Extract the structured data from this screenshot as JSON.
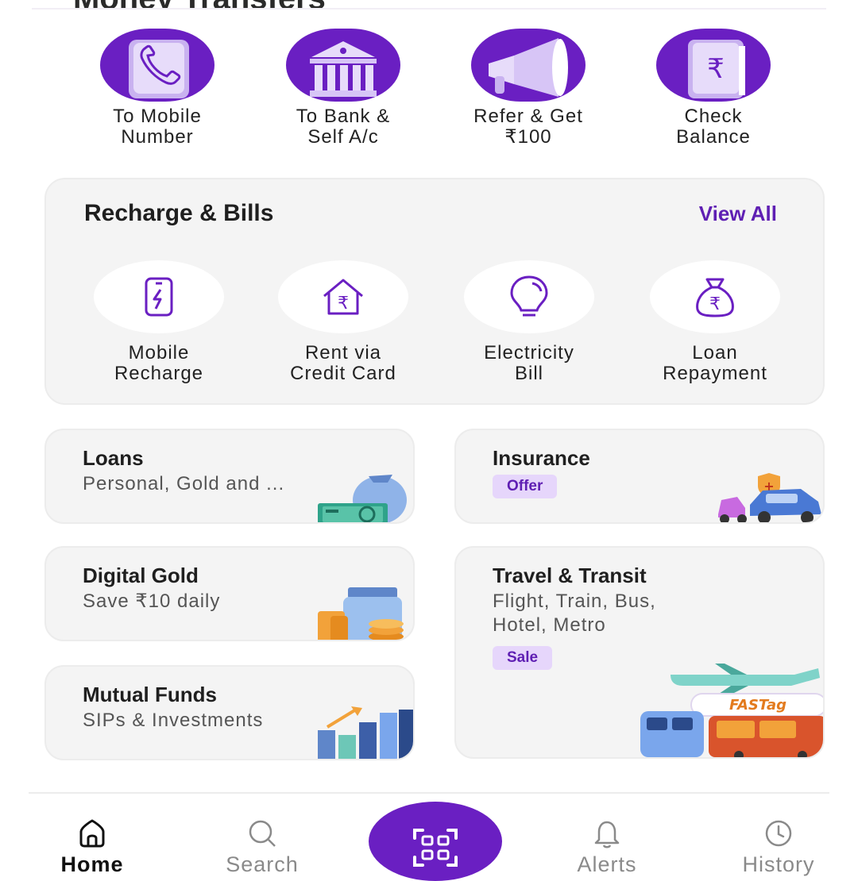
{
  "header": {
    "title_clipped": "Money Transfers"
  },
  "money_transfer": [
    {
      "label_line1": "To Mobile",
      "label_line2": "Number",
      "icon": "phone-icon"
    },
    {
      "label_line1": "To Bank &",
      "label_line2": "Self A/c",
      "icon": "bank-icon"
    },
    {
      "label_line1": "Refer & Get",
      "label_line2": "₹100",
      "icon": "megaphone-icon"
    },
    {
      "label_line1": "Check",
      "label_line2": "Balance",
      "icon": "rupee-book-icon"
    }
  ],
  "recharge_bills": {
    "title": "Recharge & Bills",
    "view_all": "View All",
    "items": [
      {
        "label_line1": "Mobile",
        "label_line2": "Recharge",
        "icon": "mobile-recharge-icon"
      },
      {
        "label_line1": "Rent via",
        "label_line2": "Credit Card",
        "icon": "house-rupee-icon"
      },
      {
        "label_line1": "Electricity",
        "label_line2": "Bill",
        "icon": "bulb-icon"
      },
      {
        "label_line1": "Loan",
        "label_line2": "Repayment",
        "icon": "money-bag-icon"
      }
    ]
  },
  "cards": {
    "loans": {
      "title": "Loans",
      "subtitle": "Personal, Gold and ..."
    },
    "insurance": {
      "title": "Insurance",
      "badge": "Offer"
    },
    "digital_gold": {
      "title": "Digital Gold",
      "subtitle": "Save ₹10 daily"
    },
    "travel": {
      "title": "Travel & Transit",
      "subtitle_line1": "Flight, Train, Bus,",
      "subtitle_line2": "Hotel, Metro",
      "badge": "Sale",
      "fastag": "FASTag"
    },
    "mutual_funds": {
      "title": "Mutual Funds",
      "subtitle": "SIPs & Investments"
    }
  },
  "bottom_nav": {
    "home": "Home",
    "search": "Search",
    "alerts": "Alerts",
    "history": "History"
  },
  "colors": {
    "brand_purple": "#6a1fc2",
    "accent_purple": "#5f1fb3",
    "badge_bg": "#e6d6fb"
  }
}
